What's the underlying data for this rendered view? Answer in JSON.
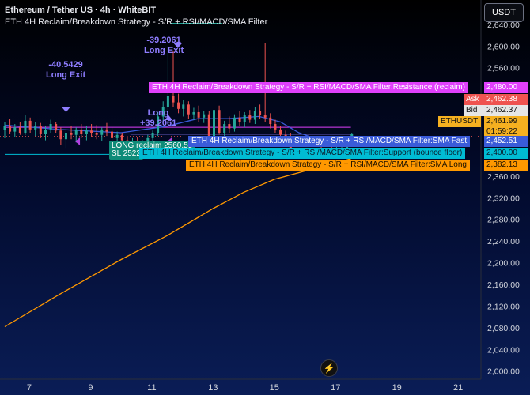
{
  "header": {
    "symbol_line": "Ethereum / Tether US · 4h · WhiteBIT",
    "indicator_line": "ETH 4H Reclaim/Breakdown Strategy - S/R + RSI/MACD/SMA Filter"
  },
  "currency_button": "USDT",
  "colors": {
    "bull": "#26a69a",
    "bear": "#ef5350",
    "resistance": "#e040fb",
    "support": "#00bcd4",
    "sma_fast": "#3a5bd9",
    "sma_long": "#ff9800",
    "exit": "#8e7dff",
    "current": "#f5b020"
  },
  "chart_data": {
    "type": "candlestick",
    "ylim": [
      1985,
      2685
    ],
    "y_ticks": [
      "2,640.00",
      "2,600.00",
      "2,560.00",
      "2,520.00",
      "2,480.00",
      "2,440.00",
      "2,400.00",
      "2,360.00",
      "2,320.00",
      "2,280.00",
      "2,240.00",
      "2,200.00",
      "2,160.00",
      "2,120.00",
      "2,080.00",
      "2,040.00",
      "2,000.00"
    ],
    "y_tick_values": [
      2640,
      2600,
      2560,
      2520,
      2480,
      2440,
      2400,
      2360,
      2320,
      2280,
      2240,
      2200,
      2160,
      2120,
      2080,
      2040,
      2000
    ],
    "x_ticks": [
      "7",
      "9",
      "11",
      "13",
      "15",
      "17",
      "19",
      "21"
    ],
    "x_tick_days": [
      7,
      9,
      11,
      13,
      15,
      17,
      19,
      21
    ],
    "xlim_days": [
      6.2,
      21.9
    ],
    "candles": [
      {
        "d": 6.2,
        "o": 2445,
        "h": 2460,
        "l": 2430,
        "c": 2452
      },
      {
        "d": 6.37,
        "o": 2452,
        "h": 2466,
        "l": 2438,
        "c": 2442
      },
      {
        "d": 6.53,
        "o": 2442,
        "h": 2456,
        "l": 2432,
        "c": 2450
      },
      {
        "d": 6.7,
        "o": 2450,
        "h": 2460,
        "l": 2436,
        "c": 2440
      },
      {
        "d": 6.87,
        "o": 2440,
        "h": 2472,
        "l": 2436,
        "c": 2462
      },
      {
        "d": 7.03,
        "o": 2462,
        "h": 2468,
        "l": 2440,
        "c": 2446
      },
      {
        "d": 7.2,
        "o": 2446,
        "h": 2460,
        "l": 2434,
        "c": 2452
      },
      {
        "d": 7.37,
        "o": 2452,
        "h": 2458,
        "l": 2430,
        "c": 2438
      },
      {
        "d": 7.53,
        "o": 2438,
        "h": 2452,
        "l": 2426,
        "c": 2446
      },
      {
        "d": 7.7,
        "o": 2446,
        "h": 2464,
        "l": 2440,
        "c": 2456
      },
      {
        "d": 7.87,
        "o": 2456,
        "h": 2460,
        "l": 2440,
        "c": 2444
      },
      {
        "d": 8.03,
        "o": 2444,
        "h": 2450,
        "l": 2418,
        "c": 2428
      },
      {
        "d": 8.2,
        "o": 2428,
        "h": 2444,
        "l": 2412,
        "c": 2440
      },
      {
        "d": 8.37,
        "o": 2440,
        "h": 2452,
        "l": 2428,
        "c": 2436
      },
      {
        "d": 8.53,
        "o": 2436,
        "h": 2450,
        "l": 2422,
        "c": 2446
      },
      {
        "d": 8.7,
        "o": 2446,
        "h": 2456,
        "l": 2430,
        "c": 2438
      },
      {
        "d": 8.87,
        "o": 2438,
        "h": 2452,
        "l": 2426,
        "c": 2444
      },
      {
        "d": 9.03,
        "o": 2444,
        "h": 2456,
        "l": 2432,
        "c": 2440
      },
      {
        "d": 9.2,
        "o": 2440,
        "h": 2454,
        "l": 2428,
        "c": 2436
      },
      {
        "d": 9.37,
        "o": 2436,
        "h": 2450,
        "l": 2424,
        "c": 2446
      },
      {
        "d": 9.53,
        "o": 2446,
        "h": 2458,
        "l": 2434,
        "c": 2442
      },
      {
        "d": 9.7,
        "o": 2442,
        "h": 2450,
        "l": 2420,
        "c": 2430
      },
      {
        "d": 9.87,
        "o": 2430,
        "h": 2442,
        "l": 2416,
        "c": 2436
      },
      {
        "d": 10.03,
        "o": 2436,
        "h": 2440,
        "l": 2420,
        "c": 2426
      },
      {
        "d": 10.2,
        "o": 2426,
        "h": 2434,
        "l": 2408,
        "c": 2414
      },
      {
        "d": 10.37,
        "o": 2414,
        "h": 2430,
        "l": 2404,
        "c": 2424
      },
      {
        "d": 10.53,
        "o": 2424,
        "h": 2432,
        "l": 2406,
        "c": 2412
      },
      {
        "d": 10.7,
        "o": 2412,
        "h": 2426,
        "l": 2400,
        "c": 2420
      },
      {
        "d": 10.87,
        "o": 2420,
        "h": 2436,
        "l": 2410,
        "c": 2430
      },
      {
        "d": 11.03,
        "o": 2430,
        "h": 2444,
        "l": 2422,
        "c": 2440
      },
      {
        "d": 11.2,
        "o": 2440,
        "h": 2478,
        "l": 2434,
        "c": 2470
      },
      {
        "d": 11.37,
        "o": 2470,
        "h": 2498,
        "l": 2462,
        "c": 2488
      },
      {
        "d": 11.53,
        "o": 2488,
        "h": 2600,
        "l": 2480,
        "c": 2508
      },
      {
        "d": 11.7,
        "o": 2508,
        "h": 2590,
        "l": 2488,
        "c": 2496
      },
      {
        "d": 11.87,
        "o": 2496,
        "h": 2512,
        "l": 2476,
        "c": 2484
      },
      {
        "d": 12.03,
        "o": 2484,
        "h": 2500,
        "l": 2470,
        "c": 2492
      },
      {
        "d": 12.2,
        "o": 2492,
        "h": 2498,
        "l": 2466,
        "c": 2474
      },
      {
        "d": 12.37,
        "o": 2474,
        "h": 2486,
        "l": 2464,
        "c": 2478
      },
      {
        "d": 12.53,
        "o": 2478,
        "h": 2490,
        "l": 2460,
        "c": 2468
      },
      {
        "d": 12.7,
        "o": 2468,
        "h": 2480,
        "l": 2458,
        "c": 2474
      },
      {
        "d": 12.87,
        "o": 2474,
        "h": 2480,
        "l": 2426,
        "c": 2432
      },
      {
        "d": 13.03,
        "o": 2432,
        "h": 2488,
        "l": 2428,
        "c": 2482
      },
      {
        "d": 13.2,
        "o": 2482,
        "h": 2490,
        "l": 2436,
        "c": 2440
      },
      {
        "d": 13.37,
        "o": 2440,
        "h": 2462,
        "l": 2434,
        "c": 2456
      },
      {
        "d": 13.53,
        "o": 2456,
        "h": 2470,
        "l": 2440,
        "c": 2448
      },
      {
        "d": 13.7,
        "o": 2448,
        "h": 2474,
        "l": 2442,
        "c": 2468
      },
      {
        "d": 13.87,
        "o": 2468,
        "h": 2480,
        "l": 2452,
        "c": 2460
      },
      {
        "d": 14.03,
        "o": 2460,
        "h": 2478,
        "l": 2450,
        "c": 2472
      },
      {
        "d": 14.2,
        "o": 2472,
        "h": 2482,
        "l": 2458,
        "c": 2464
      },
      {
        "d": 14.37,
        "o": 2464,
        "h": 2488,
        "l": 2456,
        "c": 2480
      },
      {
        "d": 14.53,
        "o": 2480,
        "h": 2492,
        "l": 2466,
        "c": 2472
      },
      {
        "d": 14.7,
        "o": 2472,
        "h": 2606,
        "l": 2460,
        "c": 2468
      },
      {
        "d": 14.87,
        "o": 2468,
        "h": 2476,
        "l": 2448,
        "c": 2456
      },
      {
        "d": 15.03,
        "o": 2456,
        "h": 2464,
        "l": 2440,
        "c": 2446
      },
      {
        "d": 15.2,
        "o": 2446,
        "h": 2452,
        "l": 2428,
        "c": 2436
      },
      {
        "d": 15.37,
        "o": 2436,
        "h": 2444,
        "l": 2426,
        "c": 2432
      },
      {
        "d": 15.53,
        "o": 2432,
        "h": 2440,
        "l": 2392,
        "c": 2400
      },
      {
        "d": 15.7,
        "o": 2400,
        "h": 2412,
        "l": 2394,
        "c": 2404
      },
      {
        "d": 15.87,
        "o": 2404,
        "h": 2408,
        "l": 2396,
        "c": 2400
      },
      {
        "d": 16.03,
        "o": 2400,
        "h": 2410,
        "l": 2392,
        "c": 2406
      },
      {
        "d": 16.2,
        "o": 2406,
        "h": 2412,
        "l": 2398,
        "c": 2402
      },
      {
        "d": 16.37,
        "o": 2402,
        "h": 2410,
        "l": 2396,
        "c": 2406
      },
      {
        "d": 16.53,
        "o": 2406,
        "h": 2414,
        "l": 2400,
        "c": 2404
      },
      {
        "d": 16.7,
        "o": 2404,
        "h": 2412,
        "l": 2398,
        "c": 2408
      },
      {
        "d": 16.87,
        "o": 2408,
        "h": 2416,
        "l": 2400,
        "c": 2406
      },
      {
        "d": 17.03,
        "o": 2406,
        "h": 2414,
        "l": 2400,
        "c": 2410
      },
      {
        "d": 17.2,
        "o": 2410,
        "h": 2418,
        "l": 2402,
        "c": 2412
      },
      {
        "d": 17.37,
        "o": 2412,
        "h": 2428,
        "l": 2406,
        "c": 2424
      },
      {
        "d": 17.53,
        "o": 2424,
        "h": 2440,
        "l": 2418,
        "c": 2438
      }
    ],
    "sma_fast": [
      [
        6.2,
        2454
      ],
      [
        8,
        2446
      ],
      [
        10,
        2440
      ],
      [
        11.5,
        2452
      ],
      [
        12.5,
        2466
      ],
      [
        13.5,
        2466
      ],
      [
        14.5,
        2470
      ],
      [
        15.2,
        2460
      ],
      [
        15.8,
        2440
      ],
      [
        16.5,
        2426
      ],
      [
        17.5,
        2415
      ]
    ],
    "sma_long": [
      [
        6.2,
        2082
      ],
      [
        8,
        2142
      ],
      [
        10,
        2206
      ],
      [
        11.5,
        2250
      ],
      [
        13,
        2300
      ],
      [
        14,
        2330
      ],
      [
        15,
        2354
      ],
      [
        16.3,
        2374
      ],
      [
        17.5,
        2392
      ]
    ],
    "levels": {
      "resistance": 2450,
      "support": 2400
    },
    "resistance_line_span": [
      6.2,
      17.5
    ],
    "support_line_span": [
      6.2,
      17.5
    ],
    "reclaim_level": 2437,
    "reclaim_line_span": [
      10.3,
      17.5
    ],
    "current_price": 2461.99,
    "dotted_line": 2433,
    "markers": [
      {
        "d": 8.2,
        "price": 2478,
        "dir": "down",
        "color": "#8e7dff"
      },
      {
        "d": 11.85,
        "price": 2596,
        "dir": "down",
        "color": "#8e7dff"
      },
      {
        "d": 11.55,
        "price": 2472,
        "dir": "up",
        "color": "#8e7dff"
      },
      {
        "d": 8.5,
        "price": 2424,
        "dir": "left",
        "color": "#b040e0"
      },
      {
        "d": 11.5,
        "price": 2424,
        "dir": "left",
        "color": "#b040e0"
      }
    ]
  },
  "annotations": {
    "exit1_value": "-40.5429",
    "exit1_label": "Long Exit",
    "exit2_value": "-39.2061",
    "exit2_label": "Long Exit",
    "entry_label": "Long",
    "entry_value": "+39.2061",
    "reclaim_flag": "LONG reclaim 2560.55",
    "sl_flag": "SL 2522"
  },
  "level_labels": {
    "resistance": "ETH 4H Reclaim/Breakdown Strategy - S/R + RSI/MACD/SMA Filter:Resistance (reclaim)",
    "sma_fast": "ETH 4H Reclaim/Breakdown Strategy - S/R + RSI/MACD/SMA Filter:SMA Fast",
    "support": "ETH 4H Reclaim/Breakdown Strategy - S/R + RSI/MACD/SMA Filter:Support (bounce floor)",
    "sma_long": "ETH 4H Reclaim/Breakdown Strategy - S/R + RSI/MACD/SMA Filter:SMA Long"
  },
  "price_tags": {
    "resistance_value": "2,480.00",
    "ask_label": "Ask",
    "ask_value": "2,462.38",
    "bid_label": "Bid",
    "bid_value": "2,462.37",
    "symbol_label": "ETHUSDT",
    "current_value": "2,461.99",
    "countdown": "01:59:22",
    "sma_fast_value": "2,452.51",
    "support_value": "2,400.00",
    "sma_long_value": "2,382.13"
  }
}
